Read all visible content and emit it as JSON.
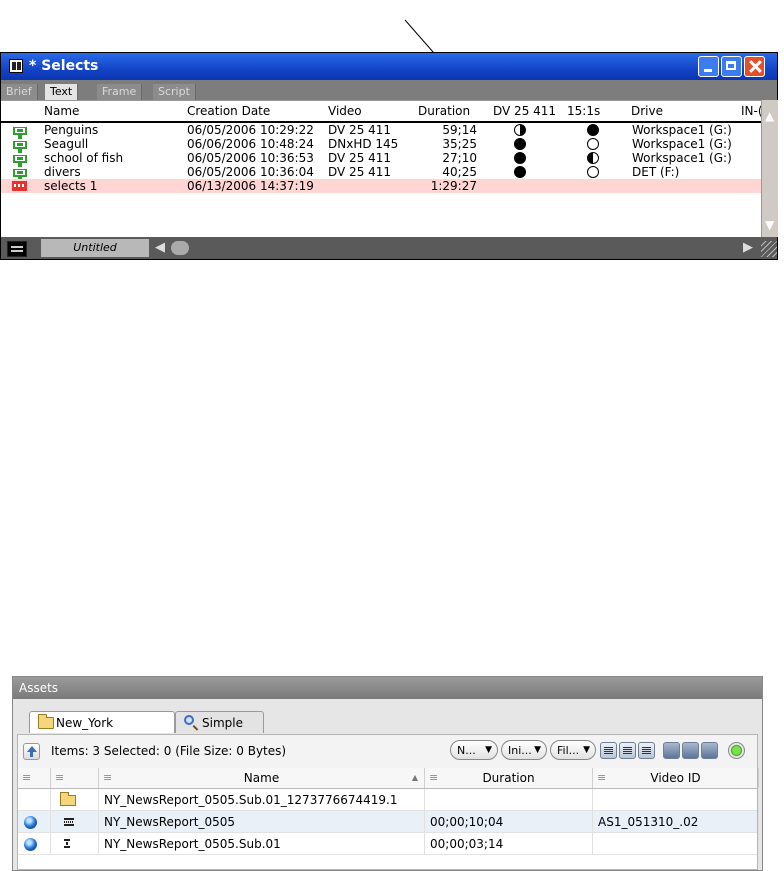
{
  "bin": {
    "title": "* Selects",
    "tabs": [
      "Brief",
      "Text",
      "Frame",
      "Script"
    ],
    "active_tab": "Text",
    "columns": [
      "Name",
      "Creation Date",
      "Video",
      "Duration",
      "DV 25 411",
      "15:1s",
      "Drive",
      "IN-("
    ],
    "rows": [
      {
        "type": "clip",
        "name": "Penguins",
        "date": "06/05/2006 10:29:22",
        "video": "DV 25 411",
        "duration": "59;14",
        "dv": "half",
        "s15": "full",
        "drive": "Workspace1 (G:)"
      },
      {
        "type": "clip",
        "name": "Seagull",
        "date": "06/06/2006 10:48:24",
        "video": "DNxHD 145",
        "duration": "35;25",
        "dv": "full",
        "s15": "empty",
        "drive": "Workspace1 (G:)"
      },
      {
        "type": "clip",
        "name": "school of fish",
        "date": "06/05/2006 10:36:53",
        "video": "DV 25 411",
        "duration": "27;10",
        "dv": "full",
        "s15": "halfl",
        "drive": "Workspace1 (G:)"
      },
      {
        "type": "clip",
        "name": "divers",
        "date": "06/05/2006 10:36:04",
        "video": "DV 25 411",
        "duration": "40;25",
        "dv": "full",
        "s15": "empty",
        "drive": "DET (F:)"
      },
      {
        "type": "sequence",
        "name": "selects 1",
        "date": "06/13/2006 14:37:19",
        "video": "",
        "duration": "1:29:27",
        "dv": "",
        "s15": "",
        "drive": "",
        "selected": true
      }
    ],
    "footer_view": "Untitled",
    "colors": {
      "title_bar": "#1344c6",
      "selected_row": "#ffd6d4",
      "clip_icon": "#2e9e2e",
      "sequence_icon": "#e5322d"
    }
  },
  "assets": {
    "panel_title": "Assets",
    "tabs": [
      {
        "label": "New_York",
        "icon": "folder-icon",
        "active": true
      },
      {
        "label": "Simple",
        "icon": "magnifier-icon",
        "active": false
      }
    ],
    "status": "Items: 3 Selected: 0 (File Size: 0 Bytes)",
    "filters": [
      "N...",
      "Ini...",
      "Fil..."
    ],
    "columns": [
      "Name",
      "Duration",
      "Video ID"
    ],
    "rows": [
      {
        "status_icon": "",
        "type_icon": "folder-icon",
        "name": "NY_NewsReport_0505.Sub.01_1273776674419.1",
        "duration": "",
        "video_id": ""
      },
      {
        "status_icon": "globe-icon",
        "type_icon": "sequence-icon",
        "name": "NY_NewsReport_0505",
        "duration": "00;00;10;04",
        "video_id": "AS1_051310_.02"
      },
      {
        "status_icon": "globe-icon",
        "type_icon": "subclip-icon",
        "name": "NY_NewsReport_0505.Sub.01",
        "duration": "00;00;03;14",
        "video_id": ""
      }
    ]
  }
}
